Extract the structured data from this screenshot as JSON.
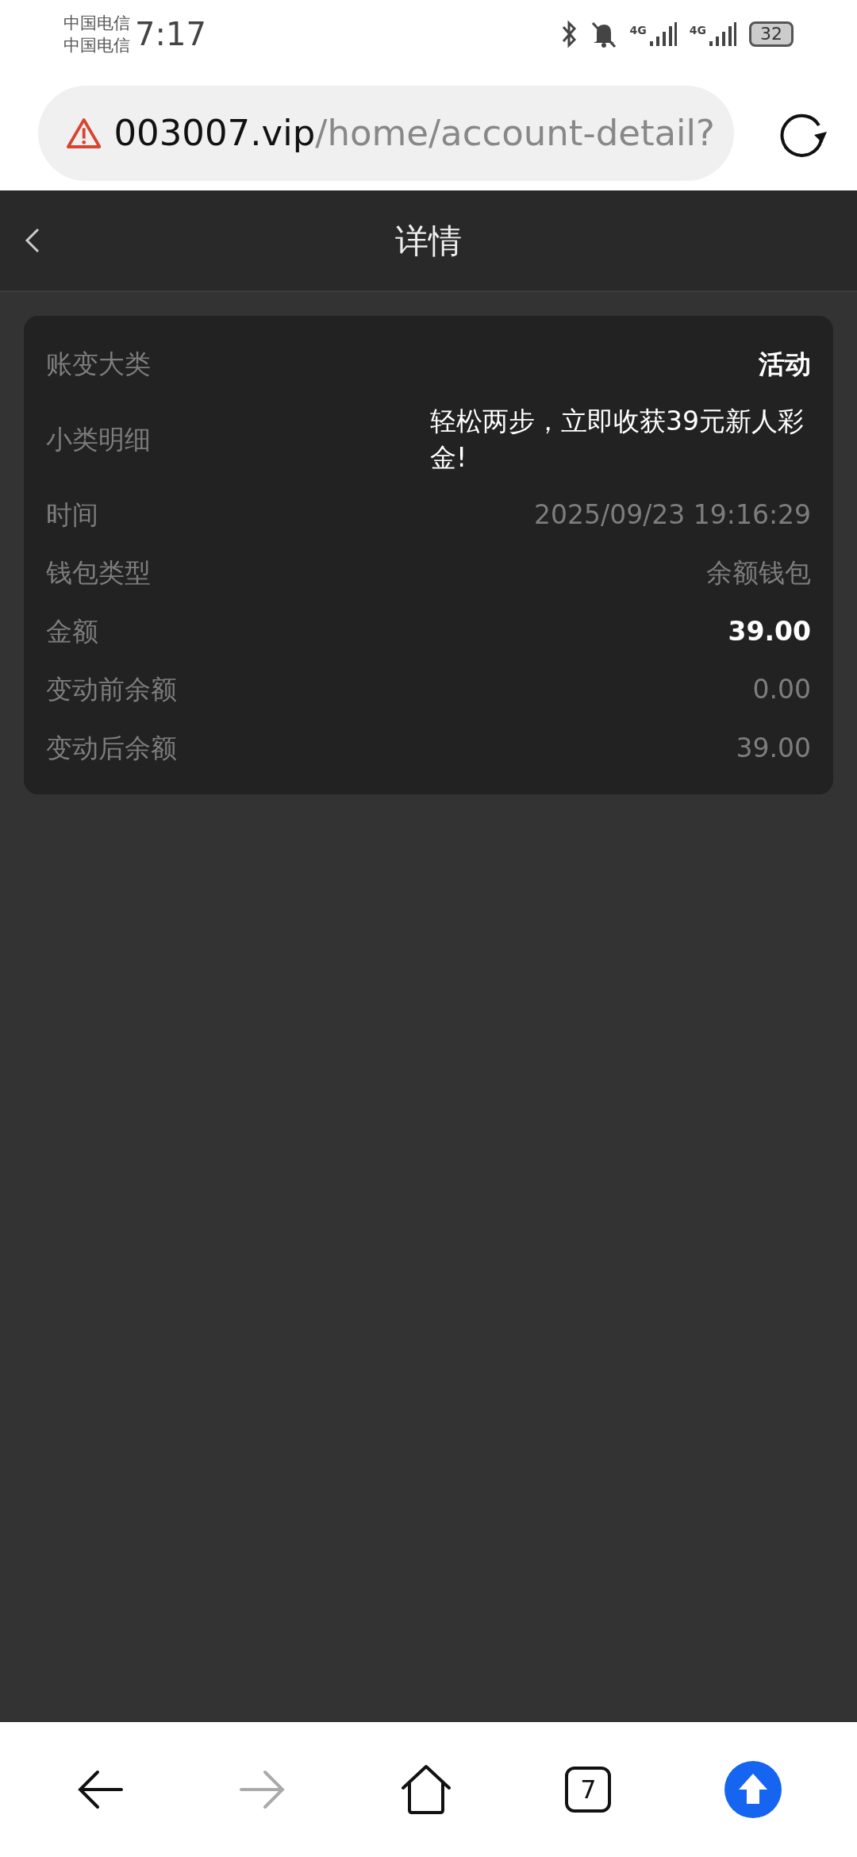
{
  "status_bar": {
    "carriers": [
      "中国电信",
      "中国电信"
    ],
    "time": "7:17",
    "signals": [
      "4G",
      "4G"
    ],
    "battery": "32"
  },
  "address_bar": {
    "host": "003007.vip",
    "path": "/home/account-detail?"
  },
  "header": {
    "title": "详情"
  },
  "details": [
    {
      "label": "账变大类",
      "value": "活动",
      "kind": "strong"
    },
    {
      "label": "小类明细",
      "value": "轻松两步，立即收获39元新人彩金!",
      "kind": "plain"
    },
    {
      "label": "时间",
      "value": "2025/09/23 19:16:29",
      "kind": "muted"
    },
    {
      "label": "钱包类型",
      "value": "余额钱包",
      "kind": "muted"
    },
    {
      "label": "金额",
      "value": "39.00",
      "kind": "strong"
    },
    {
      "label": "变动前余额",
      "value": "0.00",
      "kind": "muted"
    },
    {
      "label": "变动后余额",
      "value": "39.00",
      "kind": "muted"
    }
  ],
  "browser_nav": {
    "back_disabled": false,
    "forward_disabled": true,
    "tabs_count": "7"
  }
}
